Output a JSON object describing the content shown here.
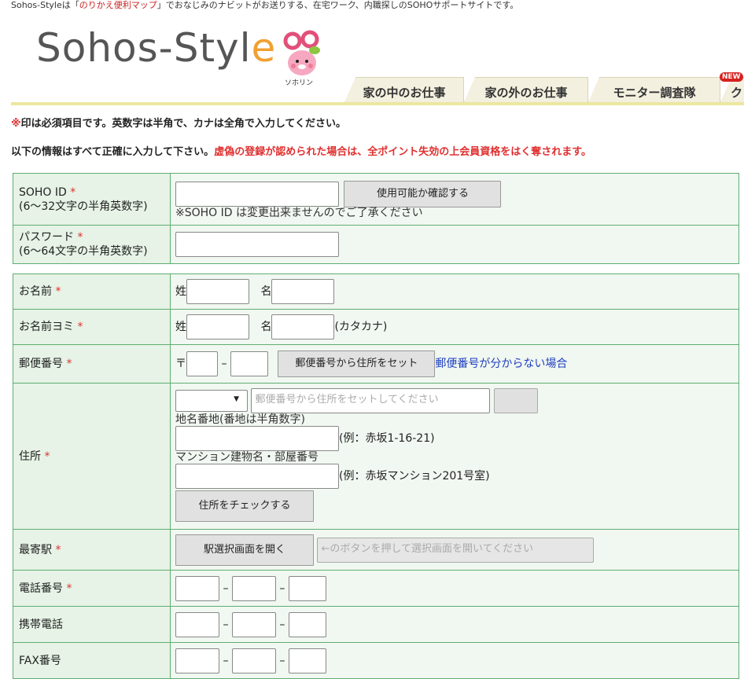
{
  "header": {
    "tagline_prefix": "Sohos-Styleは「",
    "tagline_link": "のりかえ便利マップ",
    "tagline_suffix": "」でおなじみのナビットがお送りする、在宅ワーク、内職探しのSOHOサポートサイトです。",
    "logo_main": "Sohos-Styl",
    "logo_e": "e",
    "mascot_caption": "ソホリン",
    "tabs": [
      "家の中のお仕事",
      "家の外のお仕事",
      "モニター調査隊",
      "ク"
    ],
    "new_badge": "NEW"
  },
  "notes": {
    "required_mark": "※",
    "required_text": "印は必須項目です。英数字は半角で、カナは全角で入力してください。",
    "accuracy_text": "以下の情報はすべて正確に入力して下さい。",
    "warning_text": "虚偽の登録が認められた場合は、全ポイント失効の上会員資格をはく奪されます。"
  },
  "required_star": "*",
  "account": {
    "soho_id": {
      "label": "SOHO ID",
      "hint": "(6～32文字の半角英数字)",
      "value": "",
      "button": "使用可能か確認する",
      "note": "※SOHO ID は変更出来ませんのでご了承ください"
    },
    "password": {
      "label": "パスワード",
      "hint": "(6～64文字の半角英数字)",
      "value": ""
    }
  },
  "profile": {
    "name": {
      "label": "お名前",
      "sei": "姓",
      "mei": "名"
    },
    "name_kana": {
      "label": "お名前ヨミ",
      "sei": "姓",
      "mei": "名",
      "suffix": "(カタカナ)"
    },
    "postal": {
      "label": "郵便番号",
      "mark": "〒",
      "dash": "–",
      "button": "郵便番号から住所をセット",
      "link": "郵便番号が分からない場合"
    },
    "address": {
      "label": "住所",
      "prefecture_selected": "",
      "placeholder": "郵便番号から住所をセットしてください",
      "street_label": "地名番地(番地は半角数字)",
      "street_example": "(例：赤坂1-16-21)",
      "building_label": "マンション建物名・部屋番号",
      "building_example": "(例：赤坂マンション201号室)",
      "check_button": "住所をチェックする"
    },
    "station": {
      "label": "最寄駅",
      "button": "駅選択画面を開く",
      "placeholder": "←のボタンを押して選択画面を開いてください"
    },
    "phone": {
      "label": "電話番号",
      "dash": "–"
    },
    "mobile": {
      "label": "携帯電話",
      "dash": "–"
    },
    "fax": {
      "label": "FAX番号",
      "dash": "–"
    }
  },
  "colors": {
    "border": "#5fae72",
    "label_bg": "#e6f3e6",
    "value_bg": "#f1f7f1",
    "required": "#e03030",
    "link": "#2040c0",
    "nav_underline": "#ece7a0"
  }
}
